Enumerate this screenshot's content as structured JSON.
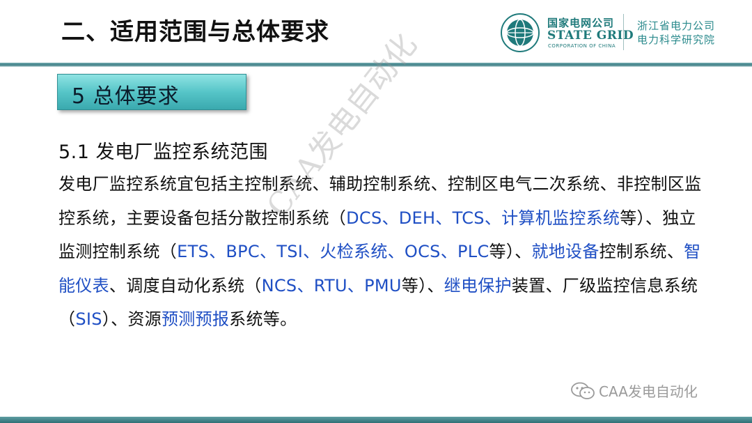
{
  "header": {
    "title": "二、适用范围与总体要求",
    "logo": {
      "cn": "国家电网公司",
      "en": "STATE GRID",
      "sub": "CORPORATION OF CHINA",
      "emblem_icon": "state-grid-emblem"
    },
    "org": [
      "浙江省电力公司",
      "电力科学研究院"
    ]
  },
  "section": {
    "label": "5 总体要求"
  },
  "subheading": "5.1  发电厂监控系统范围",
  "paragraph": [
    {
      "t": "发电厂监控系统宜包括主控制系统、辅助控制系统、控制区电气二次系统、非控制区监控系统，主要设备包括分散控制系统（",
      "hl": false
    },
    {
      "t": "DCS、DEH、TCS、计算机监控系统",
      "hl": true
    },
    {
      "t": "等）、独立监测控制系统（",
      "hl": false
    },
    {
      "t": "ETS、BPC、TSI、火检系统、OCS、PLC",
      "hl": true
    },
    {
      "t": "等）、",
      "hl": false
    },
    {
      "t": "就地设备",
      "hl": true
    },
    {
      "t": "控制系统、",
      "hl": false
    },
    {
      "t": "智能仪表",
      "hl": true
    },
    {
      "t": "、调度自动化系统（",
      "hl": false
    },
    {
      "t": "NCS、RTU、PMU",
      "hl": true
    },
    {
      "t": "等）、",
      "hl": false
    },
    {
      "t": "继电保护",
      "hl": true
    },
    {
      "t": "装置、厂级监控信息系统（",
      "hl": false
    },
    {
      "t": "SIS",
      "hl": true
    },
    {
      "t": "）、资源",
      "hl": false
    },
    {
      "t": "预测预报",
      "hl": true
    },
    {
      "t": "系统等。",
      "hl": false
    }
  ],
  "watermark": "CAA发电自动化",
  "wechat": {
    "icon": "wechat-icon",
    "text": "CAA发电自动化"
  },
  "colors": {
    "accent": "#1f7a7b",
    "highlight": "#1f4fc4",
    "section_fill": "#56c5c8"
  }
}
